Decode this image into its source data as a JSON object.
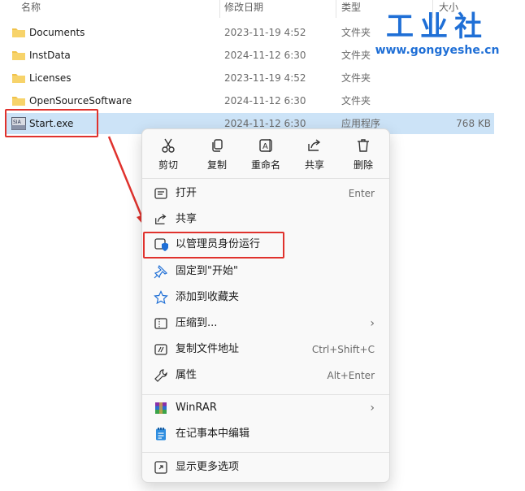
{
  "columns": {
    "name": "名称",
    "date": "修改日期",
    "type": "类型",
    "size": "大小"
  },
  "files": [
    {
      "name": "Documents",
      "date": "2023-11-19 4:52",
      "type": "文件夹",
      "size": "",
      "icon": "folder-icon"
    },
    {
      "name": "InstData",
      "date": "2024-11-12 6:30",
      "type": "文件夹",
      "size": "",
      "icon": "folder-icon"
    },
    {
      "name": "Licenses",
      "date": "2023-11-19 4:52",
      "type": "文件夹",
      "size": "",
      "icon": "folder-icon"
    },
    {
      "name": "OpenSourceSoftware",
      "date": "2024-11-12 6:30",
      "type": "文件夹",
      "size": "",
      "icon": "folder-icon"
    },
    {
      "name": "Start.exe",
      "date": "2024-11-12 6:30",
      "type": "应用程序",
      "size": "768 KB",
      "icon": "exe-icon",
      "selected": true
    }
  ],
  "context_menu": {
    "toolbar": [
      {
        "label": "剪切",
        "icon": "scissors-icon"
      },
      {
        "label": "复制",
        "icon": "copy-icon"
      },
      {
        "label": "重命名",
        "icon": "rename-icon"
      },
      {
        "label": "共享",
        "icon": "share-icon"
      },
      {
        "label": "删除",
        "icon": "trash-icon"
      }
    ],
    "items": [
      {
        "label": "打开",
        "shortcut": "Enter",
        "icon": "open-icon"
      },
      {
        "label": "共享",
        "shortcut": "",
        "icon": "share-icon"
      },
      {
        "label": "以管理员身份运行",
        "shortcut": "",
        "icon": "shield-icon",
        "highlighted": true
      },
      {
        "label": "固定到\"开始\"",
        "shortcut": "",
        "icon": "pin-icon"
      },
      {
        "label": "添加到收藏夹",
        "shortcut": "",
        "icon": "star-icon"
      },
      {
        "label": "压缩到...",
        "shortcut": "",
        "icon": "zip-icon",
        "submenu": true
      },
      {
        "label": "复制文件地址",
        "shortcut": "Ctrl+Shift+C",
        "icon": "copy-path-icon"
      },
      {
        "label": "属性",
        "shortcut": "Alt+Enter",
        "icon": "wrench-icon"
      },
      {
        "label": "WinRAR",
        "shortcut": "",
        "icon": "winrar-icon",
        "submenu": true
      },
      {
        "label": "在记事本中编辑",
        "shortcut": "",
        "icon": "notepad-icon"
      },
      {
        "label": "显示更多选项",
        "shortcut": "",
        "icon": "more-options-icon"
      }
    ],
    "submenu_arrow": "›"
  },
  "watermark": {
    "title": "工业社",
    "url": "www.gongyeshe.cn"
  },
  "colors": {
    "highlight": "#e0322d",
    "selection": "#cce3f7",
    "folder": "#f0c24a",
    "accent": "#1f6fd6"
  }
}
